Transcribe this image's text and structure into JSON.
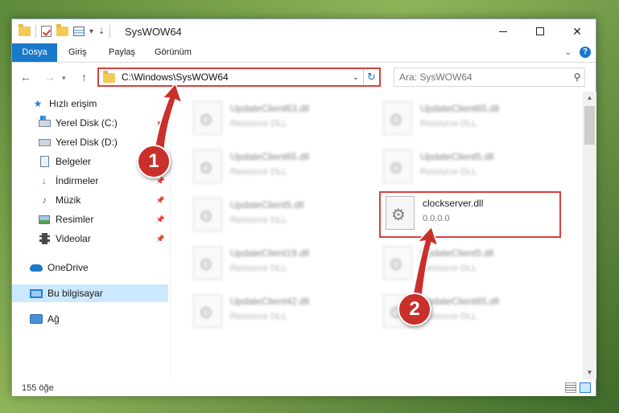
{
  "window": {
    "title": "SysWOW64"
  },
  "ribbon": {
    "tabs": [
      {
        "label": "Dosya"
      },
      {
        "label": "Giriş"
      },
      {
        "label": "Paylaş"
      },
      {
        "label": "Görünüm"
      }
    ],
    "help": "?"
  },
  "address": {
    "path": "C:\\Windows\\SysWOW64"
  },
  "search": {
    "placeholder": "Ara: SysWOW64"
  },
  "nav": {
    "items": [
      {
        "label": "Hızlı erişim"
      },
      {
        "label": "Yerel Disk (C:)"
      },
      {
        "label": "Yerel Disk (D:)"
      },
      {
        "label": "Belgeler"
      },
      {
        "label": "İndirmeler"
      },
      {
        "label": "Müzik"
      },
      {
        "label": "Resimler"
      },
      {
        "label": "Videolar"
      },
      {
        "label": "OneDrive"
      },
      {
        "label": "Bu bilgisayar"
      },
      {
        "label": "Ağ"
      }
    ]
  },
  "files": [
    {
      "name": "UpdateClient63.dll",
      "sub": "Resource DLL"
    },
    {
      "name": "UpdateClient65.dll",
      "sub": "Resource DLL"
    },
    {
      "name": "UpdateClient65.dll",
      "sub": "Resource DLL"
    },
    {
      "name": "UpdateClient5.dll",
      "sub": "Resource DLL"
    },
    {
      "name": "UpdateClient5.dll",
      "sub": "Resource DLL"
    },
    {
      "name": "clockserver.dll",
      "sub": "0.0.0.0"
    },
    {
      "name": "UpdateClient19.dll",
      "sub": "Resource DLL"
    },
    {
      "name": "UpdateClient5.dll",
      "sub": "Resource DLL"
    },
    {
      "name": "UpdateClient42.dll",
      "sub": "Resource DLL"
    },
    {
      "name": "UpdateClient65.dll",
      "sub": "Resource DLL"
    }
  ],
  "status": {
    "count": "155 öğe"
  },
  "callouts": [
    "1",
    "2"
  ],
  "accent_color": "#1979ca",
  "highlight_color": "#d94040"
}
